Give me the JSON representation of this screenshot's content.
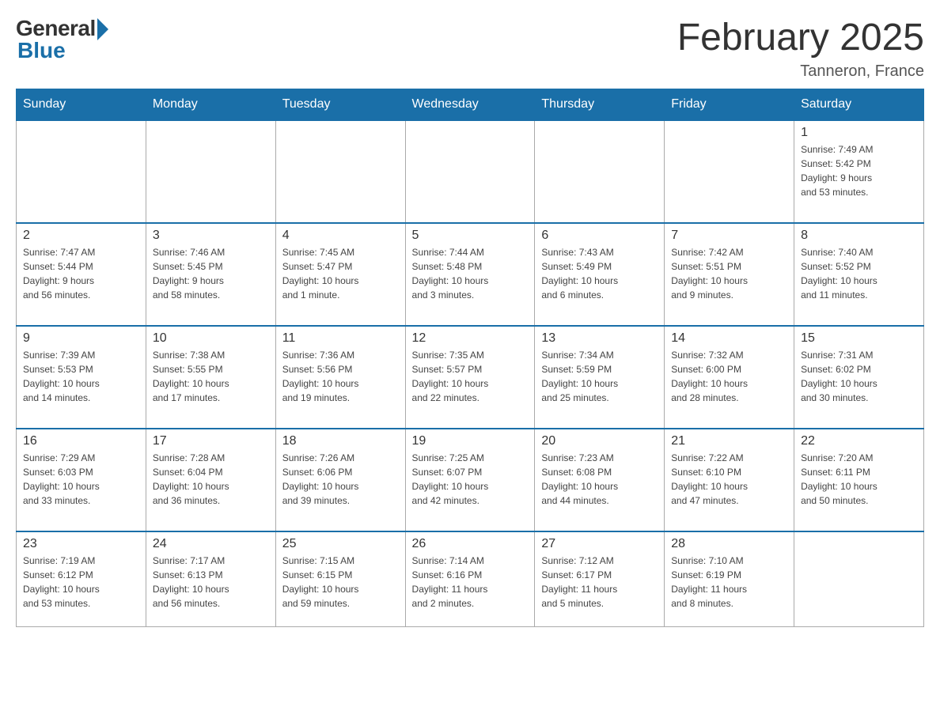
{
  "header": {
    "logo_general": "General",
    "logo_blue": "Blue",
    "month_title": "February 2025",
    "location": "Tanneron, France"
  },
  "days_of_week": [
    "Sunday",
    "Monday",
    "Tuesday",
    "Wednesday",
    "Thursday",
    "Friday",
    "Saturday"
  ],
  "weeks": [
    {
      "days": [
        {
          "number": "",
          "info": ""
        },
        {
          "number": "",
          "info": ""
        },
        {
          "number": "",
          "info": ""
        },
        {
          "number": "",
          "info": ""
        },
        {
          "number": "",
          "info": ""
        },
        {
          "number": "",
          "info": ""
        },
        {
          "number": "1",
          "info": "Sunrise: 7:49 AM\nSunset: 5:42 PM\nDaylight: 9 hours\nand 53 minutes."
        }
      ]
    },
    {
      "days": [
        {
          "number": "2",
          "info": "Sunrise: 7:47 AM\nSunset: 5:44 PM\nDaylight: 9 hours\nand 56 minutes."
        },
        {
          "number": "3",
          "info": "Sunrise: 7:46 AM\nSunset: 5:45 PM\nDaylight: 9 hours\nand 58 minutes."
        },
        {
          "number": "4",
          "info": "Sunrise: 7:45 AM\nSunset: 5:47 PM\nDaylight: 10 hours\nand 1 minute."
        },
        {
          "number": "5",
          "info": "Sunrise: 7:44 AM\nSunset: 5:48 PM\nDaylight: 10 hours\nand 3 minutes."
        },
        {
          "number": "6",
          "info": "Sunrise: 7:43 AM\nSunset: 5:49 PM\nDaylight: 10 hours\nand 6 minutes."
        },
        {
          "number": "7",
          "info": "Sunrise: 7:42 AM\nSunset: 5:51 PM\nDaylight: 10 hours\nand 9 minutes."
        },
        {
          "number": "8",
          "info": "Sunrise: 7:40 AM\nSunset: 5:52 PM\nDaylight: 10 hours\nand 11 minutes."
        }
      ]
    },
    {
      "days": [
        {
          "number": "9",
          "info": "Sunrise: 7:39 AM\nSunset: 5:53 PM\nDaylight: 10 hours\nand 14 minutes."
        },
        {
          "number": "10",
          "info": "Sunrise: 7:38 AM\nSunset: 5:55 PM\nDaylight: 10 hours\nand 17 minutes."
        },
        {
          "number": "11",
          "info": "Sunrise: 7:36 AM\nSunset: 5:56 PM\nDaylight: 10 hours\nand 19 minutes."
        },
        {
          "number": "12",
          "info": "Sunrise: 7:35 AM\nSunset: 5:57 PM\nDaylight: 10 hours\nand 22 minutes."
        },
        {
          "number": "13",
          "info": "Sunrise: 7:34 AM\nSunset: 5:59 PM\nDaylight: 10 hours\nand 25 minutes."
        },
        {
          "number": "14",
          "info": "Sunrise: 7:32 AM\nSunset: 6:00 PM\nDaylight: 10 hours\nand 28 minutes."
        },
        {
          "number": "15",
          "info": "Sunrise: 7:31 AM\nSunset: 6:02 PM\nDaylight: 10 hours\nand 30 minutes."
        }
      ]
    },
    {
      "days": [
        {
          "number": "16",
          "info": "Sunrise: 7:29 AM\nSunset: 6:03 PM\nDaylight: 10 hours\nand 33 minutes."
        },
        {
          "number": "17",
          "info": "Sunrise: 7:28 AM\nSunset: 6:04 PM\nDaylight: 10 hours\nand 36 minutes."
        },
        {
          "number": "18",
          "info": "Sunrise: 7:26 AM\nSunset: 6:06 PM\nDaylight: 10 hours\nand 39 minutes."
        },
        {
          "number": "19",
          "info": "Sunrise: 7:25 AM\nSunset: 6:07 PM\nDaylight: 10 hours\nand 42 minutes."
        },
        {
          "number": "20",
          "info": "Sunrise: 7:23 AM\nSunset: 6:08 PM\nDaylight: 10 hours\nand 44 minutes."
        },
        {
          "number": "21",
          "info": "Sunrise: 7:22 AM\nSunset: 6:10 PM\nDaylight: 10 hours\nand 47 minutes."
        },
        {
          "number": "22",
          "info": "Sunrise: 7:20 AM\nSunset: 6:11 PM\nDaylight: 10 hours\nand 50 minutes."
        }
      ]
    },
    {
      "days": [
        {
          "number": "23",
          "info": "Sunrise: 7:19 AM\nSunset: 6:12 PM\nDaylight: 10 hours\nand 53 minutes."
        },
        {
          "number": "24",
          "info": "Sunrise: 7:17 AM\nSunset: 6:13 PM\nDaylight: 10 hours\nand 56 minutes."
        },
        {
          "number": "25",
          "info": "Sunrise: 7:15 AM\nSunset: 6:15 PM\nDaylight: 10 hours\nand 59 minutes."
        },
        {
          "number": "26",
          "info": "Sunrise: 7:14 AM\nSunset: 6:16 PM\nDaylight: 11 hours\nand 2 minutes."
        },
        {
          "number": "27",
          "info": "Sunrise: 7:12 AM\nSunset: 6:17 PM\nDaylight: 11 hours\nand 5 minutes."
        },
        {
          "number": "28",
          "info": "Sunrise: 7:10 AM\nSunset: 6:19 PM\nDaylight: 11 hours\nand 8 minutes."
        },
        {
          "number": "",
          "info": ""
        }
      ]
    }
  ]
}
